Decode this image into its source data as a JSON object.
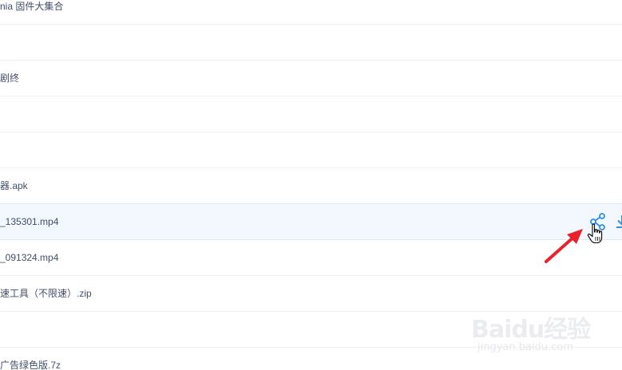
{
  "file_list": {
    "rows": [
      {
        "name": "nia 固件大集合"
      },
      {
        "name": ""
      },
      {
        "name": "剧终"
      },
      {
        "name": ""
      },
      {
        "name": ""
      },
      {
        "name": "器.apk"
      },
      {
        "name": "_135301.mp4",
        "selected": true
      },
      {
        "name": "_091324.mp4"
      },
      {
        "name": "速工具（不限速）.zip"
      },
      {
        "name": ""
      },
      {
        "name": "广告绿色版.7z"
      }
    ]
  },
  "row_actions": {
    "share_icon": "share-icon",
    "download_icon": "download-icon"
  },
  "annotation": {
    "arrow_color": "#e8232a",
    "pointer": "hand-pointer-icon"
  },
  "watermark": {
    "main": "Baidu经验",
    "sub": "jingyan.baidu.com"
  },
  "colors": {
    "accent": "#2e8fe6",
    "text": "#424e67",
    "selected_bg": "#f2f8fe"
  }
}
